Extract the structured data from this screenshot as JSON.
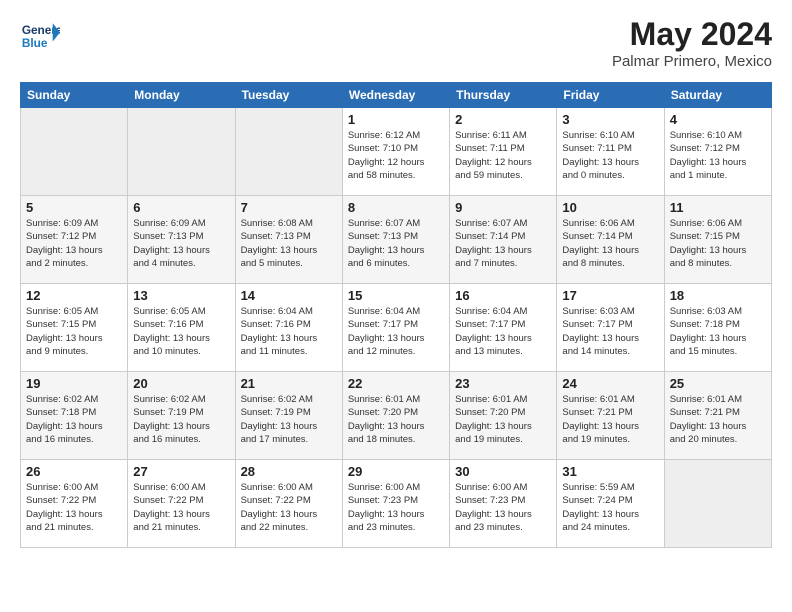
{
  "header": {
    "logo_text_general": "General",
    "logo_text_blue": "Blue",
    "month_year": "May 2024",
    "location": "Palmar Primero, Mexico"
  },
  "days_of_week": [
    "Sunday",
    "Monday",
    "Tuesday",
    "Wednesday",
    "Thursday",
    "Friday",
    "Saturday"
  ],
  "weeks": [
    [
      {
        "day": "",
        "info": ""
      },
      {
        "day": "",
        "info": ""
      },
      {
        "day": "",
        "info": ""
      },
      {
        "day": "1",
        "info": "Sunrise: 6:12 AM\nSunset: 7:10 PM\nDaylight: 12 hours\nand 58 minutes."
      },
      {
        "day": "2",
        "info": "Sunrise: 6:11 AM\nSunset: 7:11 PM\nDaylight: 12 hours\nand 59 minutes."
      },
      {
        "day": "3",
        "info": "Sunrise: 6:10 AM\nSunset: 7:11 PM\nDaylight: 13 hours\nand 0 minutes."
      },
      {
        "day": "4",
        "info": "Sunrise: 6:10 AM\nSunset: 7:12 PM\nDaylight: 13 hours\nand 1 minute."
      }
    ],
    [
      {
        "day": "5",
        "info": "Sunrise: 6:09 AM\nSunset: 7:12 PM\nDaylight: 13 hours\nand 2 minutes."
      },
      {
        "day": "6",
        "info": "Sunrise: 6:09 AM\nSunset: 7:13 PM\nDaylight: 13 hours\nand 4 minutes."
      },
      {
        "day": "7",
        "info": "Sunrise: 6:08 AM\nSunset: 7:13 PM\nDaylight: 13 hours\nand 5 minutes."
      },
      {
        "day": "8",
        "info": "Sunrise: 6:07 AM\nSunset: 7:13 PM\nDaylight: 13 hours\nand 6 minutes."
      },
      {
        "day": "9",
        "info": "Sunrise: 6:07 AM\nSunset: 7:14 PM\nDaylight: 13 hours\nand 7 minutes."
      },
      {
        "day": "10",
        "info": "Sunrise: 6:06 AM\nSunset: 7:14 PM\nDaylight: 13 hours\nand 8 minutes."
      },
      {
        "day": "11",
        "info": "Sunrise: 6:06 AM\nSunset: 7:15 PM\nDaylight: 13 hours\nand 8 minutes."
      }
    ],
    [
      {
        "day": "12",
        "info": "Sunrise: 6:05 AM\nSunset: 7:15 PM\nDaylight: 13 hours\nand 9 minutes."
      },
      {
        "day": "13",
        "info": "Sunrise: 6:05 AM\nSunset: 7:16 PM\nDaylight: 13 hours\nand 10 minutes."
      },
      {
        "day": "14",
        "info": "Sunrise: 6:04 AM\nSunset: 7:16 PM\nDaylight: 13 hours\nand 11 minutes."
      },
      {
        "day": "15",
        "info": "Sunrise: 6:04 AM\nSunset: 7:17 PM\nDaylight: 13 hours\nand 12 minutes."
      },
      {
        "day": "16",
        "info": "Sunrise: 6:04 AM\nSunset: 7:17 PM\nDaylight: 13 hours\nand 13 minutes."
      },
      {
        "day": "17",
        "info": "Sunrise: 6:03 AM\nSunset: 7:17 PM\nDaylight: 13 hours\nand 14 minutes."
      },
      {
        "day": "18",
        "info": "Sunrise: 6:03 AM\nSunset: 7:18 PM\nDaylight: 13 hours\nand 15 minutes."
      }
    ],
    [
      {
        "day": "19",
        "info": "Sunrise: 6:02 AM\nSunset: 7:18 PM\nDaylight: 13 hours\nand 16 minutes."
      },
      {
        "day": "20",
        "info": "Sunrise: 6:02 AM\nSunset: 7:19 PM\nDaylight: 13 hours\nand 16 minutes."
      },
      {
        "day": "21",
        "info": "Sunrise: 6:02 AM\nSunset: 7:19 PM\nDaylight: 13 hours\nand 17 minutes."
      },
      {
        "day": "22",
        "info": "Sunrise: 6:01 AM\nSunset: 7:20 PM\nDaylight: 13 hours\nand 18 minutes."
      },
      {
        "day": "23",
        "info": "Sunrise: 6:01 AM\nSunset: 7:20 PM\nDaylight: 13 hours\nand 19 minutes."
      },
      {
        "day": "24",
        "info": "Sunrise: 6:01 AM\nSunset: 7:21 PM\nDaylight: 13 hours\nand 19 minutes."
      },
      {
        "day": "25",
        "info": "Sunrise: 6:01 AM\nSunset: 7:21 PM\nDaylight: 13 hours\nand 20 minutes."
      }
    ],
    [
      {
        "day": "26",
        "info": "Sunrise: 6:00 AM\nSunset: 7:22 PM\nDaylight: 13 hours\nand 21 minutes."
      },
      {
        "day": "27",
        "info": "Sunrise: 6:00 AM\nSunset: 7:22 PM\nDaylight: 13 hours\nand 21 minutes."
      },
      {
        "day": "28",
        "info": "Sunrise: 6:00 AM\nSunset: 7:22 PM\nDaylight: 13 hours\nand 22 minutes."
      },
      {
        "day": "29",
        "info": "Sunrise: 6:00 AM\nSunset: 7:23 PM\nDaylight: 13 hours\nand 23 minutes."
      },
      {
        "day": "30",
        "info": "Sunrise: 6:00 AM\nSunset: 7:23 PM\nDaylight: 13 hours\nand 23 minutes."
      },
      {
        "day": "31",
        "info": "Sunrise: 5:59 AM\nSunset: 7:24 PM\nDaylight: 13 hours\nand 24 minutes."
      },
      {
        "day": "",
        "info": ""
      }
    ]
  ]
}
